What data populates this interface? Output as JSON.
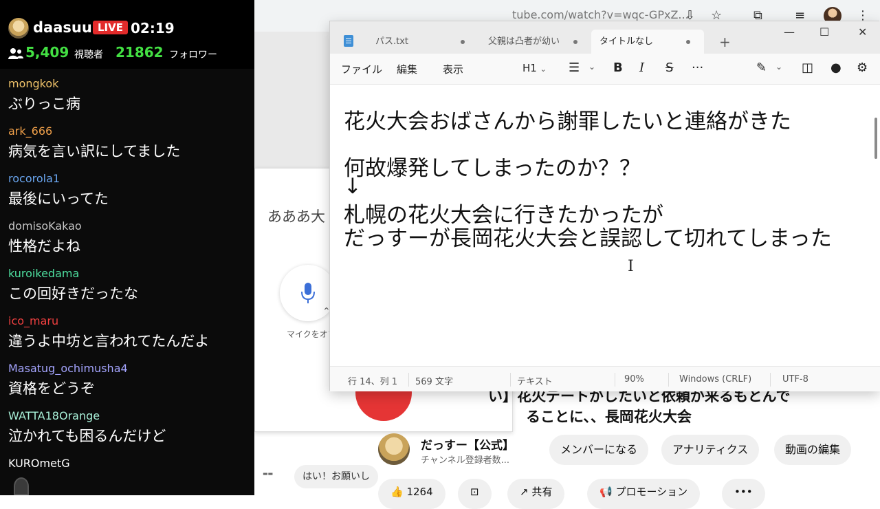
{
  "stream": {
    "streamer_name": "daasuu",
    "live_label": "LIVE",
    "live_time": "02:19",
    "viewers": "5,409",
    "viewers_label": "視聴者",
    "followers": "21862",
    "followers_label": "フォロワー",
    "chat": [
      {
        "user": "mongkok",
        "color": "#f0c36a",
        "text": "ぶりっこ病"
      },
      {
        "user": "ark_666",
        "color": "#f0a04a",
        "text": "病気を言い訳にしてました"
      },
      {
        "user": "rocorola1",
        "color": "#6aa6f0",
        "text": "最後にいってた"
      },
      {
        "user": "domisoKakao",
        "color": "#c8c8c8",
        "text": "性格だよね"
      },
      {
        "user": "kuroikedama",
        "color": "#4ee0a0",
        "text": "この回好きだったな"
      },
      {
        "user": "ico_maru",
        "color": "#f04040",
        "text": "違うよ中坊と言われてたんだよ"
      },
      {
        "user": "Masatug_ochimusha4",
        "color": "#a5a5ff",
        "text": "資格をどうぞ"
      },
      {
        "user": "WATTA18Orange",
        "color": "#a8f0d8",
        "text": "泣かれても困るんだけど"
      },
      {
        "user": "KUROmetG",
        "color": "#ffffff",
        "text": ""
      }
    ]
  },
  "browser": {
    "url": "tube.com/watch?v=wqc-GPxZ...",
    "voice_text": "あああ大",
    "mic_label": "マイクをオフ",
    "video_title_line1": "い】花火デートがしたいと依頼が来るもとんで",
    "video_title_line2": "ることに、、長岡花火大会",
    "channel_name": "だっすー【公式】",
    "channel_subs": "チャンネル登録者数...",
    "buttons": {
      "member": "メンバーになる",
      "analytics": "アナリティクス",
      "edit": "動画の編集"
    },
    "like_count": "1264",
    "share_label": "共有",
    "promo_label": "プロモーション",
    "bottom_chat": "はい！お願いし"
  },
  "notepad": {
    "tabs": [
      {
        "label": "パス.txt",
        "active": false
      },
      {
        "label": "父親は凸者が幼い",
        "active": false
      },
      {
        "label": "タイトルなし",
        "active": true
      }
    ],
    "menus": {
      "file": "ファイル",
      "edit": "編集",
      "view": "表示"
    },
    "heading_label": "H1",
    "content_lines": [
      "花火大会おばさんから謝罪したいと連絡がきた",
      "",
      "何故爆発してしまったのか？？",
      "↓",
      "札幌の花火大会に行きたかったが",
      "だっすーが長岡花火大会と誤認して切れてしまった"
    ],
    "status": {
      "position": "行 14、列 1",
      "chars": "569 文字",
      "format": "テキスト",
      "zoom": "90%",
      "line_ending": "Windows (CRLF)",
      "encoding": "UTF-8"
    }
  }
}
